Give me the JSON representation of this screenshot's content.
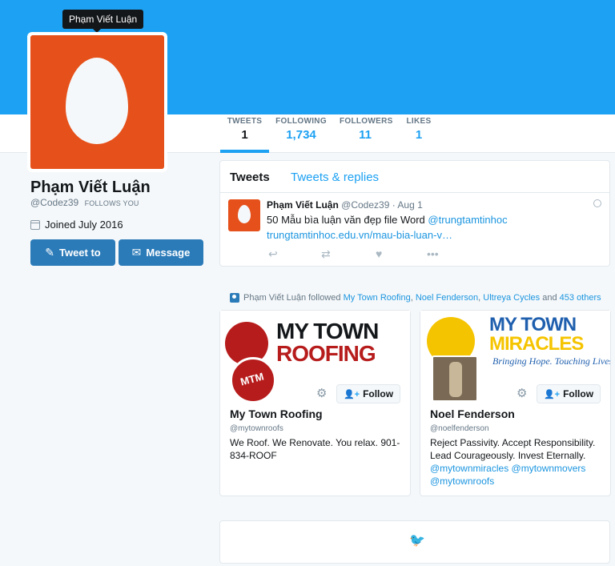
{
  "tooltip": "Phạm Viết Luận",
  "stats": [
    {
      "label": "TWEETS",
      "value": "1"
    },
    {
      "label": "FOLLOWING",
      "value": "1,734"
    },
    {
      "label": "FOLLOWERS",
      "value": "11"
    },
    {
      "label": "LIKES",
      "value": "1"
    }
  ],
  "profile": {
    "name": "Phạm Viết Luận",
    "handle": "@Codez39",
    "follows_you": "FOLLOWS YOU",
    "joined": "Joined July 2016",
    "tweet_to": "Tweet to",
    "message": "Message"
  },
  "timeline": {
    "tab_tweets": "Tweets",
    "tab_replies": "Tweets & replies",
    "tweet": {
      "name": "Phạm Viết Luận",
      "handle": "@Codez39",
      "date": "Aug 1",
      "text_part1": "50 Mẫu bìa luận văn đẹp file Word",
      "mention": "@trungtamtinhoc",
      "link": "trungtamtinhoc.edu.vn/mau-bia-luan-v…"
    }
  },
  "follow_note": {
    "prefix": "Phạm Viết Luận followed",
    "user1": "My Town Roofing",
    "sep1": ",",
    "user2": "Noel Fenderson",
    "sep2": ",",
    "user3": "Ultreya Cycles",
    "and": "and",
    "others": "453 others"
  },
  "cards": [
    {
      "banner_line1": "MY TOWN",
      "banner_line2": "ROOFING",
      "name": "My Town Roofing",
      "handle": "@mytownroofs",
      "bio": "We Roof. We Renovate. You relax. 901-834-ROOF",
      "follow": "Follow"
    },
    {
      "banner_line1": "MY TOWN",
      "banner_line2": "MIRACLES",
      "banner_tagline": "Bringing Hope. Touching Lives.",
      "name": "Noel Fenderson",
      "handle": "@noelfenderson",
      "bio": "Reject Passivity. Accept Responsibility. Lead Courageously. Invest Eternally.",
      "bio_links": "@mytownmiracles @mytownmovers @mytownroofs",
      "follow": "Follow"
    }
  ],
  "colors": {
    "brand": "#1da1f2",
    "button": "#2b7bb9",
    "avatar": "#e6501a",
    "roofing_red": "#b71c1c",
    "miracles_blue": "#1f5fae",
    "miracles_yellow": "#f5c400"
  }
}
